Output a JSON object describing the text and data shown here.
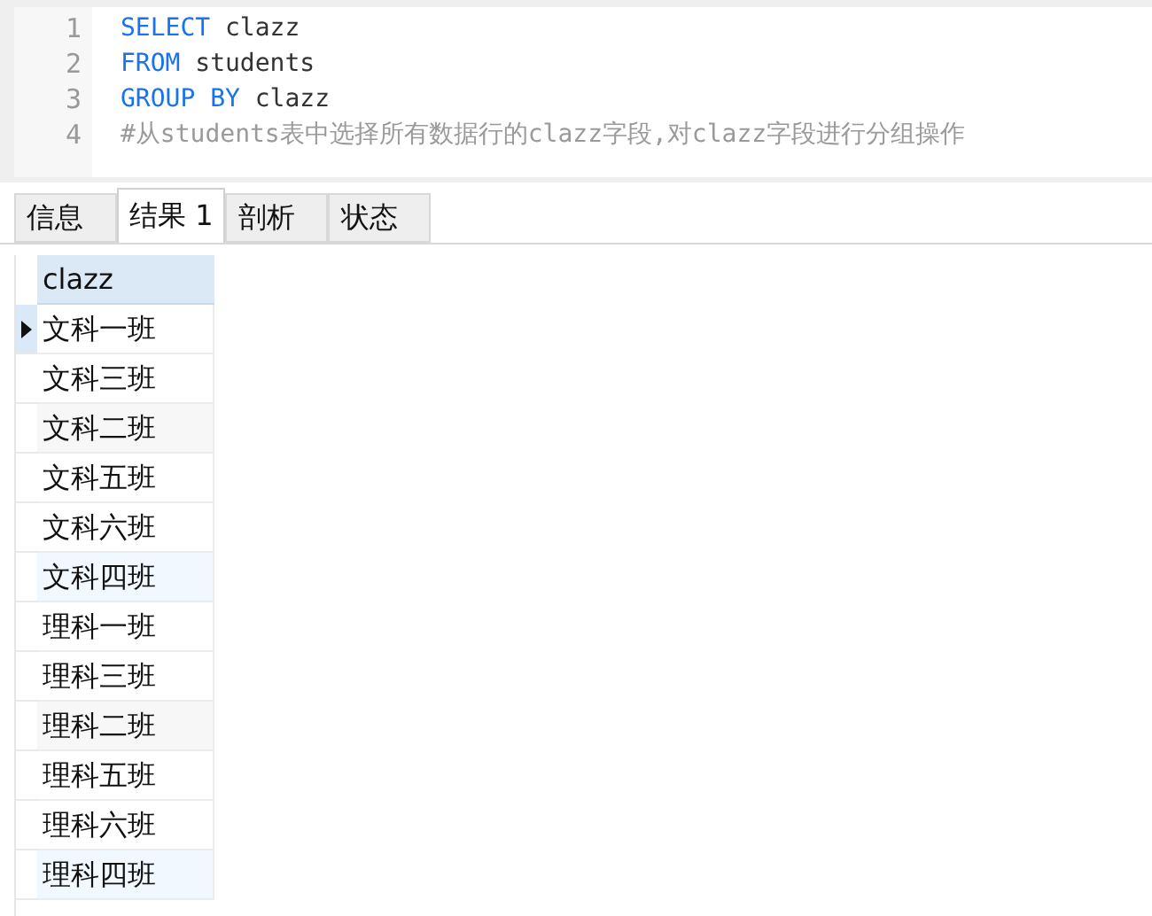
{
  "editor": {
    "lines": [
      {
        "number": "1",
        "tokens": [
          {
            "text": "SELECT",
            "kind": "keyword"
          },
          {
            "text": " clazz",
            "kind": "plain"
          }
        ]
      },
      {
        "number": "2",
        "tokens": [
          {
            "text": "FROM",
            "kind": "keyword"
          },
          {
            "text": " students",
            "kind": "plain"
          }
        ]
      },
      {
        "number": "3",
        "tokens": [
          {
            "text": "GROUP BY",
            "kind": "keyword"
          },
          {
            "text": " clazz",
            "kind": "plain"
          }
        ]
      },
      {
        "number": "4",
        "tokens": [
          {
            "text": "#从students表中选择所有数据行的clazz字段,对clazz字段进行分组操作",
            "kind": "comment"
          }
        ]
      }
    ]
  },
  "tabs": [
    {
      "label": "信息",
      "selected": false
    },
    {
      "label": "结果 1",
      "selected": true
    },
    {
      "label": "剖析",
      "selected": false
    },
    {
      "label": "状态",
      "selected": false
    }
  ],
  "table": {
    "columns": [
      "clazz"
    ],
    "rows": [
      {
        "cells": [
          "文科一班"
        ],
        "selected": true
      },
      {
        "cells": [
          "文科三班"
        ],
        "selected": false
      },
      {
        "cells": [
          "文科二班"
        ],
        "selected": false
      },
      {
        "cells": [
          "文科五班"
        ],
        "selected": false
      },
      {
        "cells": [
          "文科六班"
        ],
        "selected": false
      },
      {
        "cells": [
          "文科四班"
        ],
        "selected": false
      },
      {
        "cells": [
          "理科一班"
        ],
        "selected": false
      },
      {
        "cells": [
          "理科三班"
        ],
        "selected": false
      },
      {
        "cells": [
          "理科二班"
        ],
        "selected": false
      },
      {
        "cells": [
          "理科五班"
        ],
        "selected": false
      },
      {
        "cells": [
          "理科六班"
        ],
        "selected": false
      },
      {
        "cells": [
          "理科四班"
        ],
        "selected": false
      }
    ]
  }
}
